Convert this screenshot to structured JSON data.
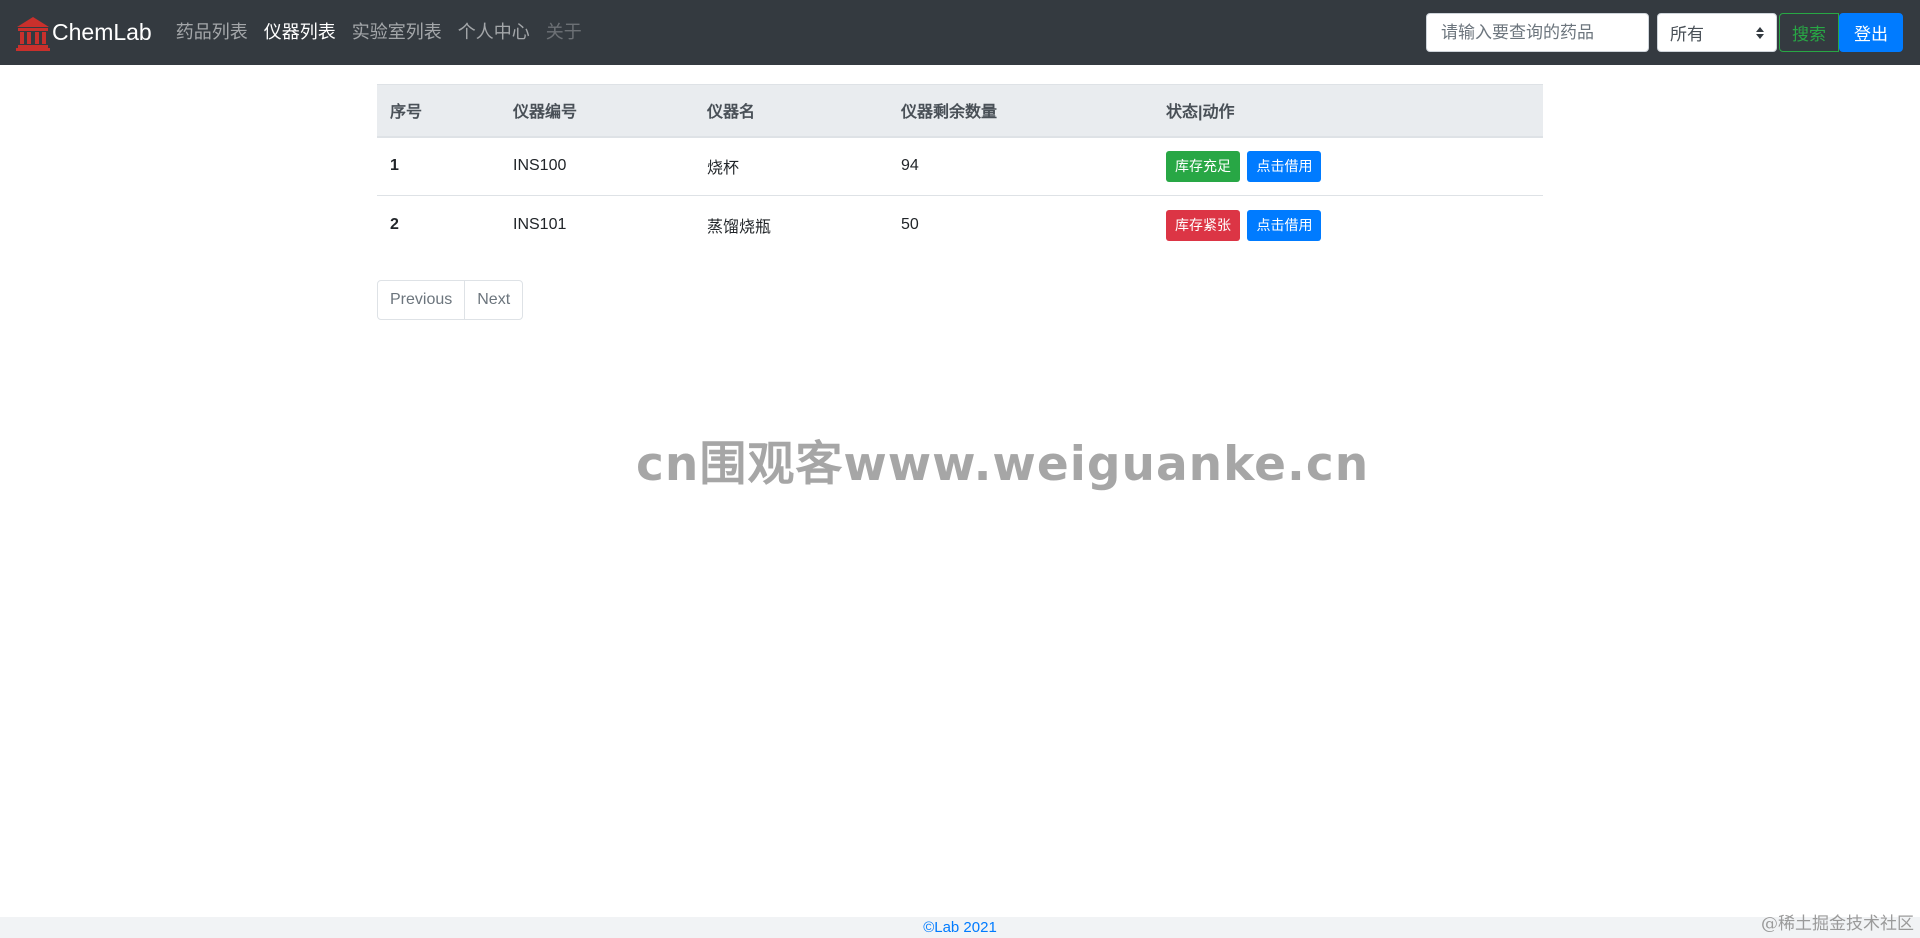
{
  "navbar": {
    "brand": "ChemLab",
    "links": [
      {
        "label": "药品列表"
      },
      {
        "label": "仪器列表"
      },
      {
        "label": "实验室列表"
      },
      {
        "label": "个人中心"
      },
      {
        "label": "关于"
      }
    ],
    "search_placeholder": "请输入要查询的药品",
    "select_value": "所有",
    "search_button": "搜索",
    "logout_button": "登出"
  },
  "table": {
    "headers": [
      "序号",
      "仪器编号",
      "仪器名",
      "仪器剩余数量",
      "状态|动作"
    ],
    "rows": [
      {
        "index": "1",
        "code": "INS100",
        "name": "烧杯",
        "quantity": "94",
        "status": "库存充足",
        "action": "点击借用"
      },
      {
        "index": "2",
        "code": "INS101",
        "name": "蒸馏烧瓶",
        "quantity": "50",
        "status": "库存紧张",
        "action": "点击借用"
      }
    ]
  },
  "pagination": {
    "previous": "Previous",
    "next": "Next"
  },
  "watermark": "cn围观客www.weiguanke.cn",
  "footer": "©Lab 2021",
  "corner_mark": "@稀土掘金技术社区",
  "colors": {
    "navbar_bg": "#343a40",
    "success": "#28a745",
    "danger": "#dc3545",
    "primary": "#007bff"
  }
}
